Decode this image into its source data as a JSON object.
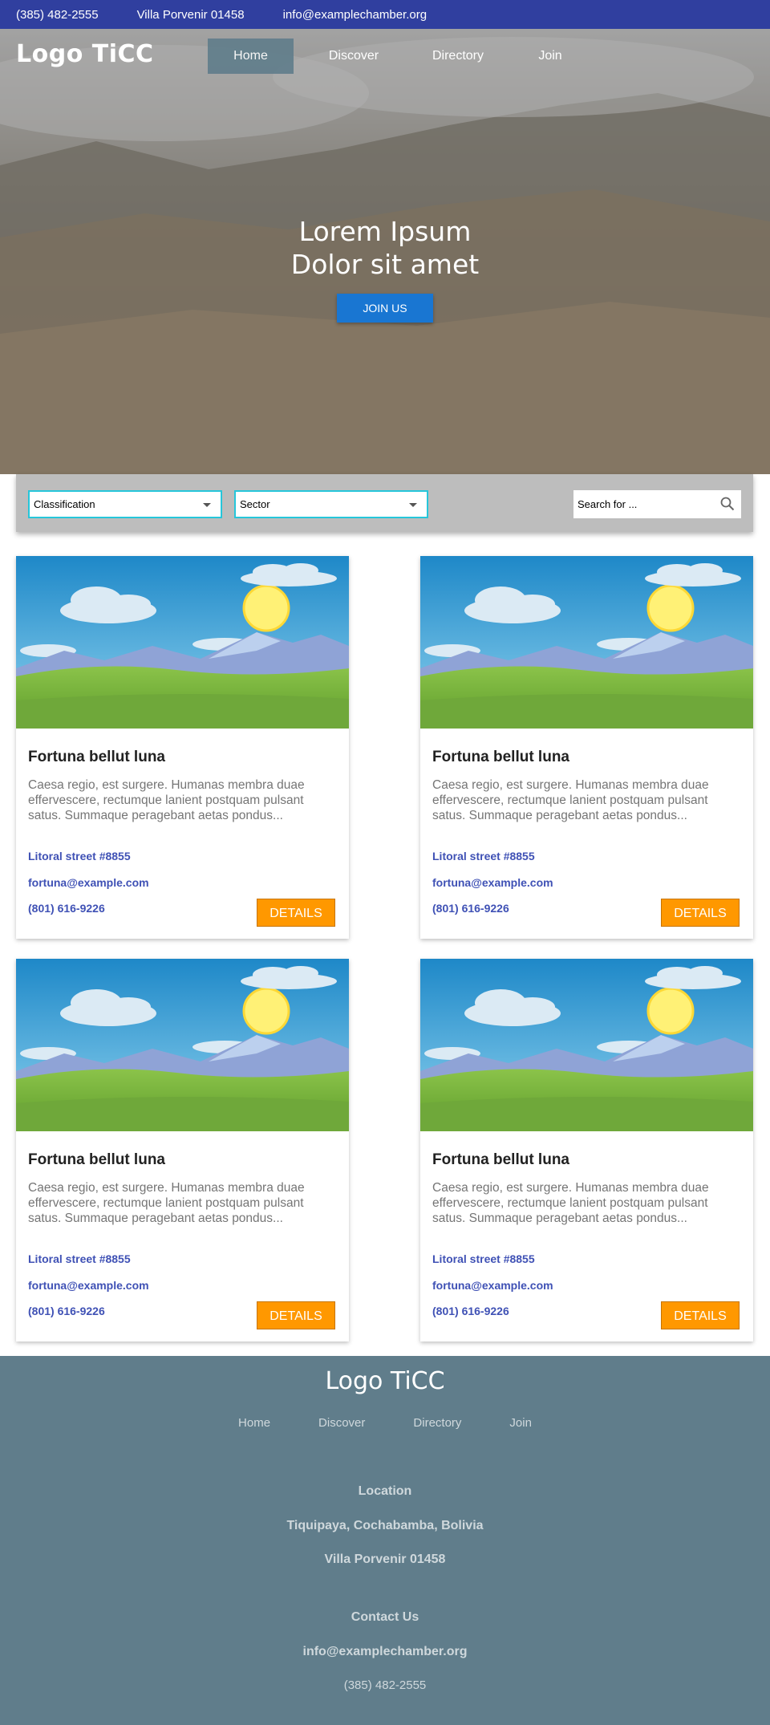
{
  "topbar": {
    "phone": "(385) 482-2555",
    "address": "Villa Porvenir 01458",
    "email": "info@examplechamber.org"
  },
  "header": {
    "logo": "Logo TiCC",
    "nav": [
      "Home",
      "Discover",
      "Directory",
      "Join"
    ],
    "active_nav": "Home"
  },
  "hero": {
    "line1": "Lorem Ipsum",
    "line2": "Dolor sit amet",
    "button": "JOIN US"
  },
  "filter": {
    "classification": "Classification",
    "sector": "Sector",
    "search_placeholder": "Search for ..."
  },
  "cards": [
    {
      "title": "Fortuna bellut luna",
      "description": "Caesa regio, est surgere. Humanas membra duae effervescere, rectumque lanient postquam pulsant satus. Summaque peragebant aetas pondus...",
      "address": "Litoral street #8855",
      "email": "fortuna@example.com",
      "phone": "(801) 616-9226",
      "button": "DETAILS"
    },
    {
      "title": "Fortuna bellut luna",
      "description": "Caesa regio, est surgere. Humanas membra duae effervescere, rectumque lanient postquam pulsant satus. Summaque peragebant aetas pondus...",
      "address": "Litoral street #8855",
      "email": "fortuna@example.com",
      "phone": "(801) 616-9226",
      "button": "DETAILS"
    },
    {
      "title": "Fortuna bellut luna",
      "description": "Caesa regio, est surgere. Humanas membra duae effervescere, rectumque lanient postquam pulsant satus. Summaque peragebant aetas pondus...",
      "address": "Litoral street #8855",
      "email": "fortuna@example.com",
      "phone": "(801) 616-9226",
      "button": "DETAILS"
    },
    {
      "title": "Fortuna bellut luna",
      "description": "Caesa regio, est surgere. Humanas membra duae effervescere, rectumque lanient postquam pulsant satus. Summaque peragebant aetas pondus...",
      "address": "Litoral street #8855",
      "email": "fortuna@example.com",
      "phone": "(801) 616-9226",
      "button": "DETAILS"
    }
  ],
  "footer": {
    "logo": "Logo TiCC",
    "nav": [
      "Home",
      "Discover",
      "Directory",
      "Join"
    ],
    "location_heading": "Location",
    "location_line1": "Tiquipaya, Cochabamba, Bolivia",
    "location_line2": "Villa Porvenir 01458",
    "contact_heading": "Contact Us",
    "contact_email": "info@examplechamber.org",
    "contact_phone": "(385) 482-2555"
  },
  "colors": {
    "topbar": "#303f9f",
    "join_button": "#1976d2",
    "details_button": "#ff9800",
    "link": "#3f51b5",
    "footer": "#607d8b",
    "select_border": "#26c6da"
  }
}
